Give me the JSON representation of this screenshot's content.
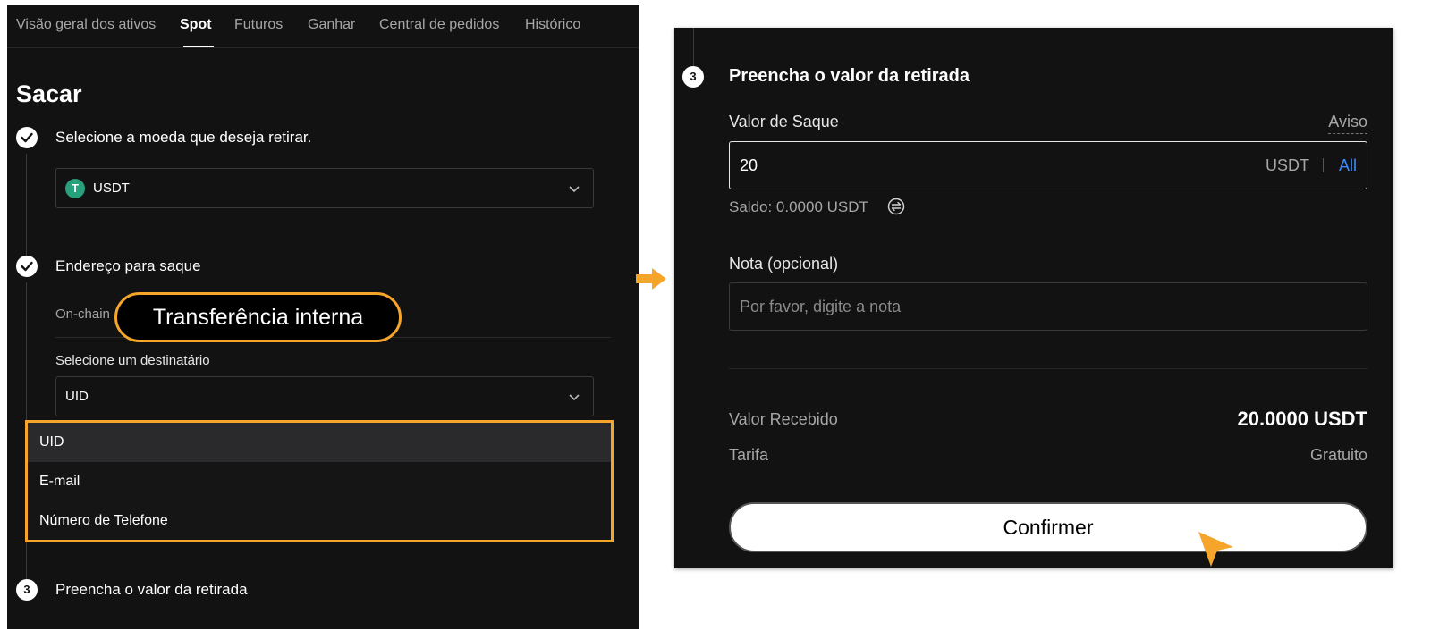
{
  "tabs": [
    {
      "label": "Visão geral dos ativos"
    },
    {
      "label": "Spot"
    },
    {
      "label": "Futuros"
    },
    {
      "label": "Ganhar"
    },
    {
      "label": "Central de pedidos"
    },
    {
      "label": "Histórico"
    }
  ],
  "page_title": "Sacar",
  "step1": {
    "title": "Selecione a moeda que deseja retirar.",
    "coin": "USDT",
    "coin_icon": "T"
  },
  "step2": {
    "title": "Endereço para saque",
    "subtab_onchain": "On-chain",
    "callout": "Transferência interna",
    "recipient_label": "Selecione um destinatário",
    "recipient_value": "UID",
    "options": [
      "UID",
      "E-mail",
      "Número de Telefone"
    ]
  },
  "step3": {
    "number": "3",
    "title": "Preencha o valor da retirada"
  },
  "withdraw_form": {
    "number": "3",
    "title": "Preencha o valor da retirada",
    "amount_label": "Valor de Saque",
    "aviso": "Aviso",
    "amount_value": "20",
    "amount_currency": "USDT",
    "all_label": "All",
    "balance": "Saldo: 0.0000 USDT",
    "note_label": "Nota (opcional)",
    "note_placeholder": "Por favor, digite a nota",
    "received_label": "Valor Recebido",
    "received_value": "20.0000 USDT",
    "fee_label": "Tarifa",
    "fee_value": "Gratuito",
    "confirm_label": "Confirmer"
  },
  "colors": {
    "highlight": "#f5a52a",
    "link": "#3d8bff",
    "background": "#121212"
  }
}
